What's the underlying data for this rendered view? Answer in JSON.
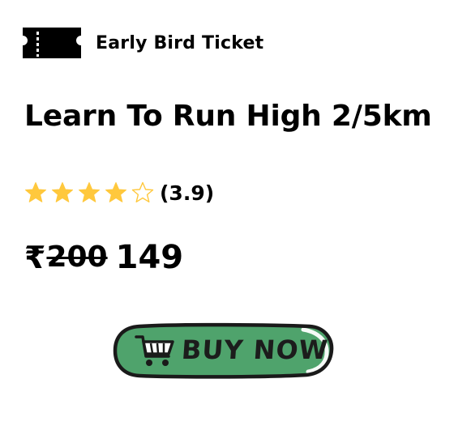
{
  "tag": {
    "icon": "ticket-icon",
    "label": "Early Bird Ticket"
  },
  "title": "Learn To Run High 2/5km",
  "rating": {
    "value": 3.9,
    "stars_filled": 4,
    "stars_total": 5,
    "label": "(3.9)",
    "star_color": "#FFC83D"
  },
  "price": {
    "currency": "₹",
    "original": "200",
    "current": "149"
  },
  "buy_button": {
    "label": "BUY NOW",
    "icon": "shopping-cart-icon",
    "color": "#4FA36C"
  }
}
